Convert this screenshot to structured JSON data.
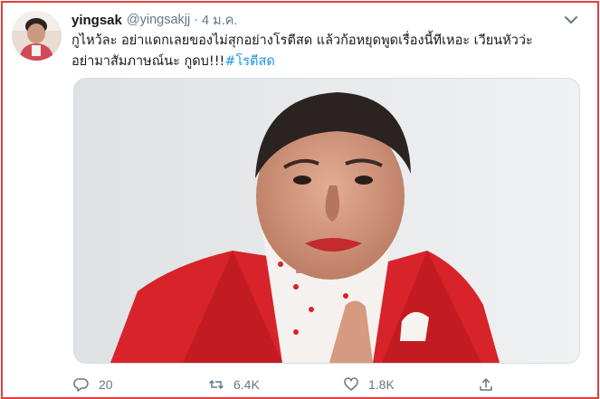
{
  "tweet": {
    "display_name": "yingsak",
    "handle": "@yingsakjj",
    "separator": "·",
    "time": "4 ม.ค.",
    "text_line1": "กูไหว้ละ อย่าแดกเลยของไม่สุกอย่างโรตีสด แล้วก้อหยุดพูดเรื่องนี้ทีเหอะ เวียนหัวว่ะ",
    "text_line2": "อย่ามาสัมภาษณ์นะ กูดบ!!!",
    "hashtag": "#โรตีสด",
    "media_alt": "photo"
  },
  "actions": {
    "replies": "20",
    "retweets": "6.4K",
    "likes": "1.8K"
  },
  "icons": [
    "avatar",
    "chevron-down-icon",
    "reply-icon",
    "retweet-icon",
    "like-icon",
    "share-icon"
  ],
  "colors": {
    "frame_border": "#e0403c",
    "link": "#1b95e0",
    "muted": "#657786",
    "jacket_red": "#d8232a"
  }
}
